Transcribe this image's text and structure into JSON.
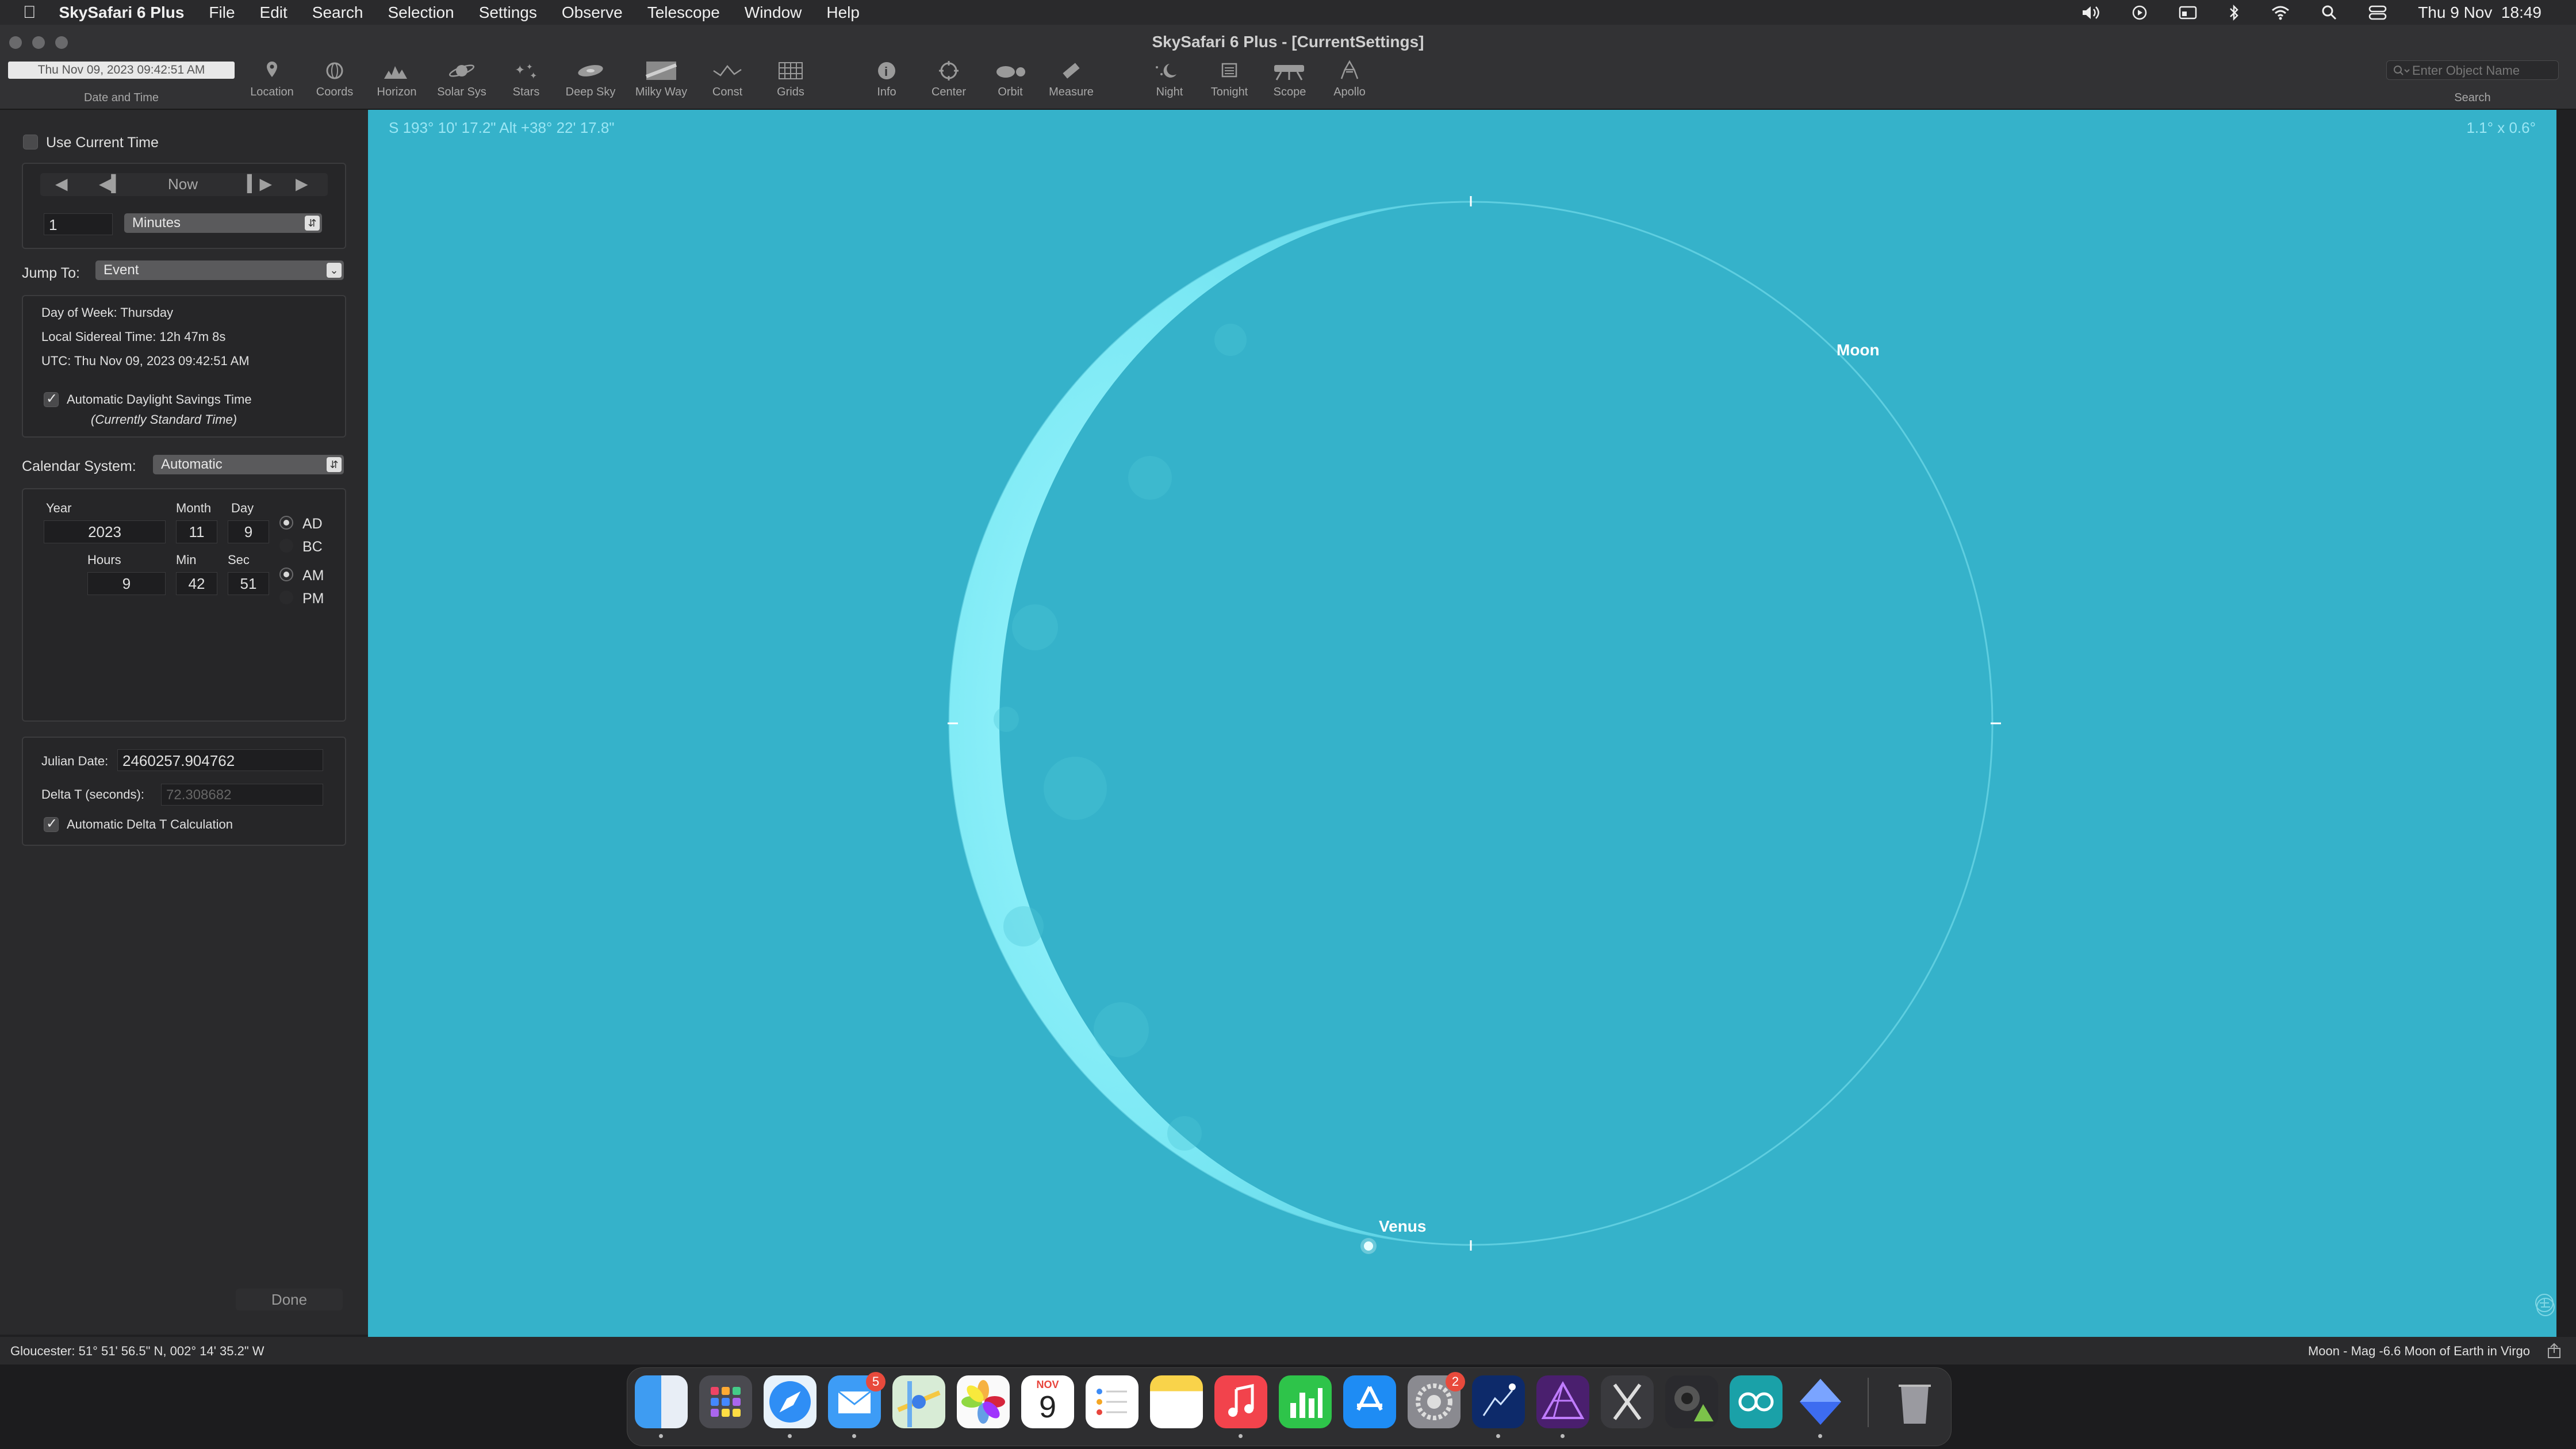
{
  "menubar": {
    "app_name": "SkySafari 6 Plus",
    "items": [
      "File",
      "Edit",
      "Search",
      "Selection",
      "Settings",
      "Observe",
      "Telescope",
      "Window",
      "Help"
    ],
    "clock": "Thu 9 Nov  18:49"
  },
  "window": {
    "title": "SkySafari 6 Plus - [CurrentSettings]",
    "date_field": "Thu Nov 09, 2023  09:42:51 AM",
    "date_label": "Date and Time",
    "toolbar": [
      "Location",
      "Coords",
      "Horizon",
      "Solar Sys",
      "Stars",
      "Deep Sky",
      "Milky Way",
      "Const",
      "Grids",
      "Info",
      "Center",
      "Orbit",
      "Measure",
      "Night",
      "Tonight",
      "Scope",
      "Apollo"
    ],
    "search_placeholder": "Enter Object Name",
    "search_label": "Search"
  },
  "panel": {
    "use_current_time": "Use Current Time",
    "now_button": "Now",
    "step_value": "1",
    "step_unit": "Minutes",
    "jump_to_label": "Jump To:",
    "jump_to_value": "Event",
    "day_of_week": "Day of Week:  Thursday",
    "sidereal": "Local Sidereal Time:  12h 47m 8s",
    "utc": "UTC:  Thu Nov 09, 2023  09:42:51 AM",
    "dst_label": "Automatic Daylight Savings Time",
    "dst_note": "(Currently Standard Time)",
    "calendar_label": "Calendar System:",
    "calendar_value": "Automatic",
    "year_label": "Year",
    "year": "2023",
    "month_label": "Month",
    "month": "11",
    "day_label": "Day",
    "day": "9",
    "hours_label": "Hours",
    "hours": "9",
    "min_label": "Min",
    "min": "42",
    "sec_label": "Sec",
    "sec": "51",
    "ad": "AD",
    "bc": "BC",
    "am": "AM",
    "pm": "PM",
    "julian_label": "Julian Date:",
    "julian_value": "2460257.904762",
    "delta_t_label": "Delta T (seconds):",
    "delta_t_value": "72.308682",
    "auto_delta_t": "Automatic Delta T Calculation",
    "done": "Done"
  },
  "sky": {
    "coords": "S 193° 10' 17.2\" Alt +38° 22' 17.8\"",
    "fov": "1.1° x  0.6°",
    "moon_label": "Moon",
    "venus_label": "Venus",
    "background": "#35b2ca"
  },
  "status": {
    "location": "Gloucester: 51° 51' 56.5\" N, 002° 14' 35.2\" W",
    "selected": "Moon - Mag -6.6 Moon of Earth in Virgo"
  },
  "dock": {
    "calendar_month": "NOV",
    "calendar_day": "9",
    "mail_badge": "5",
    "settings_badge": "2"
  }
}
